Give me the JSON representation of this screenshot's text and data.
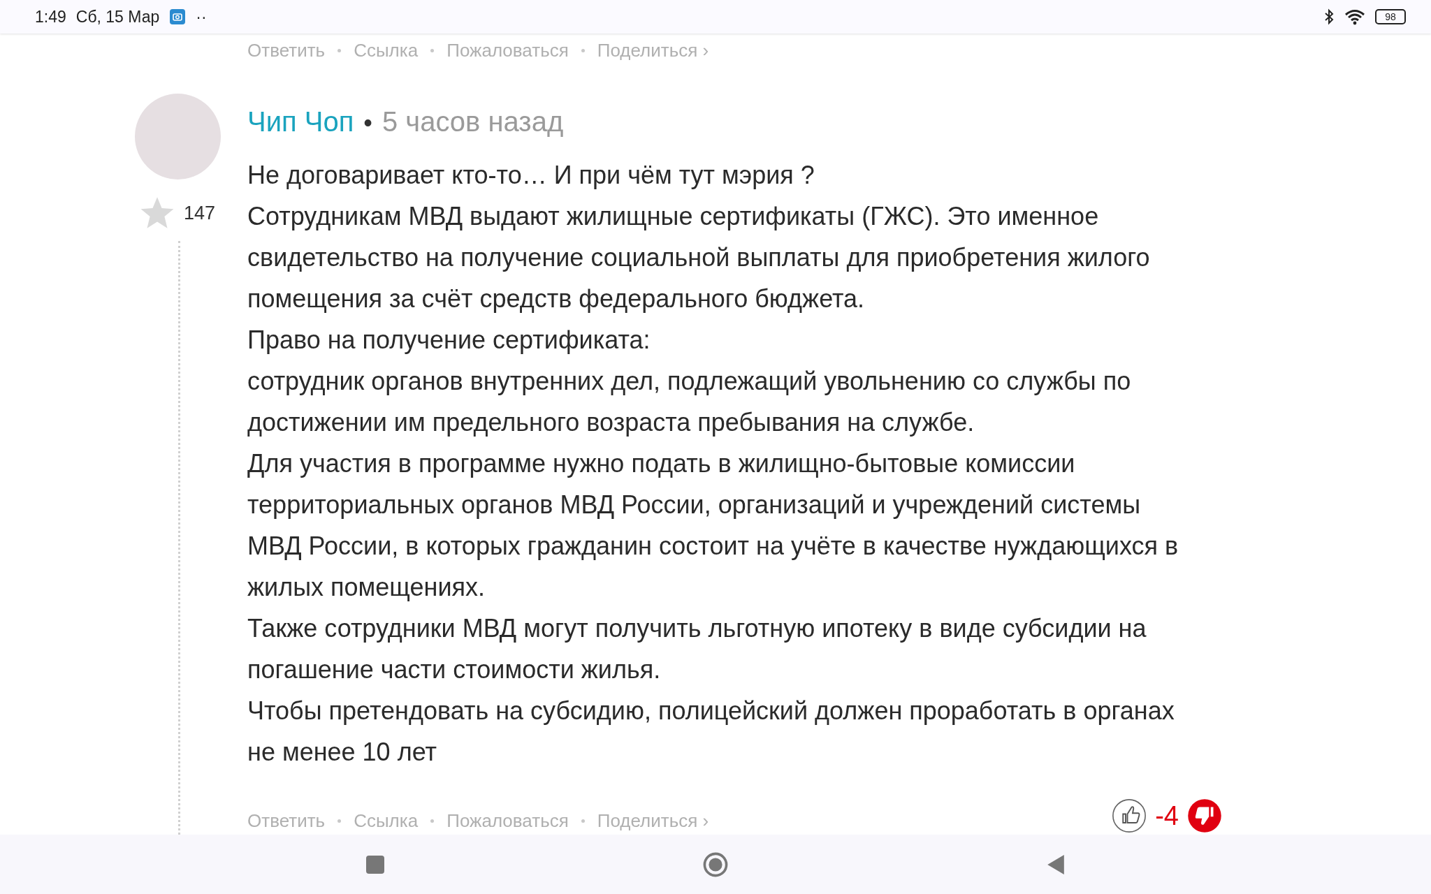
{
  "status_bar": {
    "time": "1:49",
    "date": "Сб, 15 Мар",
    "more": "··",
    "battery": "98"
  },
  "previous_comment": {
    "actions": [
      "Ответить",
      "Ссылка",
      "Пожаловаться",
      "Поделиться ›"
    ]
  },
  "comment": {
    "author": "Чип Чоп",
    "separator": "•",
    "time": "5 часов назад",
    "rating": "147",
    "lead": "Не договаривает кто-то… И при чём тут мэрия ?",
    "paragraphs": [
      "Сотрудникам МВД выдают жилищные сертификаты (ГЖС). Это именное свидетельство на получение социальной выплаты для приобретения жилого помещения за счёт средств федерального бюджета.",
      "Право на получение сертификата:",
      "сотрудник органов внутренних дел, подлежащий увольнению со службы по достижении им предельного возраста пребывания на службе.",
      "Для участия в программе нужно подать в жилищно-бытовые комиссии территориальных органов МВД России, организаций и учреждений системы МВД России, в которых гражданин состоит на учёте в качестве нуждающихся в жилых помещениях.",
      "Также сотрудники МВД могут получить льготную ипотеку в виде субсидии на погашение части стоимости жилья.",
      "Чтобы претендовать на субсидию, полицейский должен проработать в органах не менее 10 лет"
    ],
    "actions": [
      "Ответить",
      "Ссылка",
      "Пожаловаться",
      "Поделиться ›"
    ],
    "score": "-4",
    "liked": false,
    "disliked": true
  }
}
